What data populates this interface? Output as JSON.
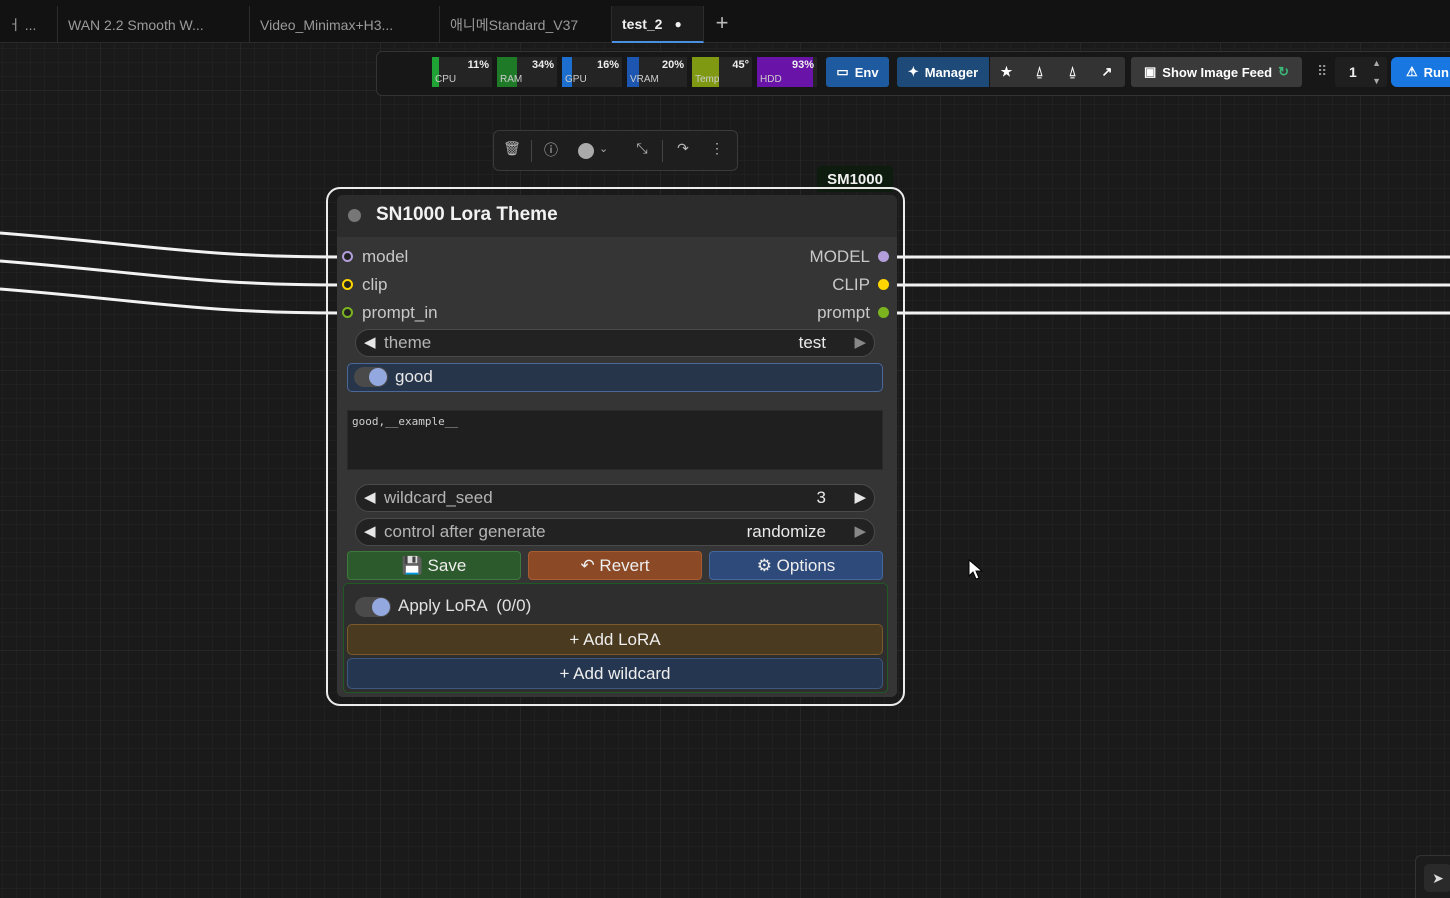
{
  "tabs": [
    {
      "label": "ㅓ ..."
    },
    {
      "label": "WAN 2.2 Smooth W..."
    },
    {
      "label": "Video_Minimax+H3..."
    },
    {
      "label": "애니메Standard_V37"
    },
    {
      "label": "test_2",
      "modified_dot": "●"
    }
  ],
  "add_tab_icon": "+",
  "stats": [
    {
      "label": "CPU",
      "value": "11%",
      "level": 0.11,
      "color": "#1fa335"
    },
    {
      "label": "RAM",
      "value": "34%",
      "level": 0.34,
      "color": "#1f7a28"
    },
    {
      "label": "GPU",
      "value": "16%",
      "level": 0.16,
      "color": "#1d6fcf"
    },
    {
      "label": "VRAM",
      "value": "20%",
      "level": 0.2,
      "color": "#1d56b0"
    },
    {
      "label": "Temp",
      "value": "45°",
      "level": 0.45,
      "color": "#7f9a12"
    },
    {
      "label": "HDD",
      "value": "93%",
      "level": 0.93,
      "color": "#6a13a8"
    }
  ],
  "topbar": {
    "env_label": "Env",
    "manager_label": "Manager",
    "image_feed_label": "Show Image Feed",
    "queue_count": "1",
    "run_label": "Run"
  },
  "node": {
    "badge": "SM1000",
    "title": "SN1000 Lora Theme",
    "inputs": [
      {
        "label": "model",
        "color": "#b39ddb"
      },
      {
        "label": "clip",
        "color": "#ffd500"
      },
      {
        "label": "prompt_in",
        "color": "#7bb41f"
      }
    ],
    "outputs": [
      {
        "label": "MODEL",
        "color": "#b39ddb"
      },
      {
        "label": "CLIP",
        "color": "#ffd500"
      },
      {
        "label": "prompt",
        "color": "#7bb41f"
      }
    ],
    "theme": {
      "name": "theme",
      "value": "test"
    },
    "toggle_good": "good",
    "prompt_text": "good,__example__",
    "wildcard_seed": {
      "name": "wildcard_seed",
      "value": "3"
    },
    "control_after_generate": {
      "name": "control after generate",
      "value": "randomize"
    },
    "save_label": "💾 Save",
    "revert_label": "↶ Revert",
    "options_label": "⚙ Options",
    "apply_lora": "Apply LoRA  (0/0)",
    "add_lora": "+ Add LoRA",
    "add_wildcard": "+ Add wildcard"
  },
  "colors": {
    "save": "#2c5a2c",
    "revert": "#8b4a25",
    "options": "#2d4a7a",
    "manager": "#1e4a7a",
    "run": "#1877e0"
  },
  "icons": [
    "trash-icon",
    "info-icon",
    "color-icon",
    "collapse-icon",
    "bypass-icon",
    "more-icon",
    "pointer-icon"
  ]
}
